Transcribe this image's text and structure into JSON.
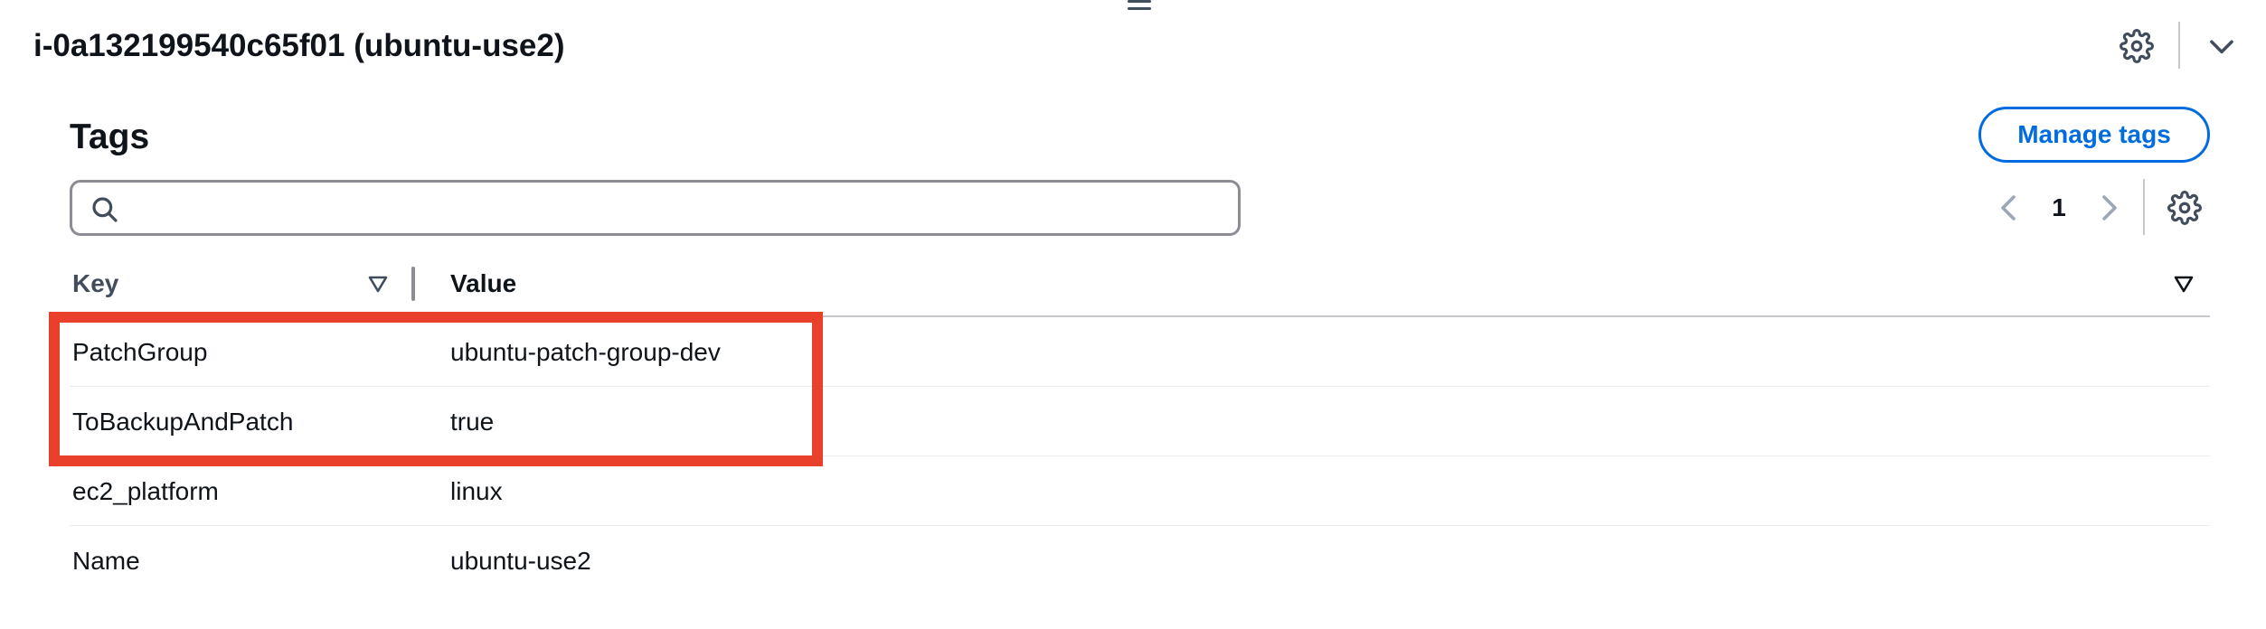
{
  "panel": {
    "instance_title": "i-0a132199540c65f01 (ubuntu-use2)"
  },
  "tags": {
    "heading": "Tags",
    "manage_button": "Manage tags",
    "search": {
      "value": "",
      "placeholder": ""
    },
    "pagination": {
      "current_page": "1"
    },
    "columns": {
      "key": "Key",
      "value": "Value"
    },
    "rows": [
      {
        "key": "PatchGroup",
        "value": "ubuntu-patch-group-dev"
      },
      {
        "key": "ToBackupAndPatch",
        "value": "true"
      },
      {
        "key": "ec2_platform",
        "value": "linux"
      },
      {
        "key": "Name",
        "value": "ubuntu-use2"
      }
    ]
  },
  "colors": {
    "accent": "#006ce0",
    "highlight": "#e8402a",
    "text": "#0f141a",
    "muted_icon": "#414d5c"
  },
  "icons": {
    "drag": "drag-handle-icon",
    "settings": "gear-icon",
    "collapse": "chevron-down-icon",
    "search": "search-icon",
    "prev": "chevron-left-icon",
    "next": "chevron-right-icon",
    "sort": "sort-caret-icon"
  }
}
